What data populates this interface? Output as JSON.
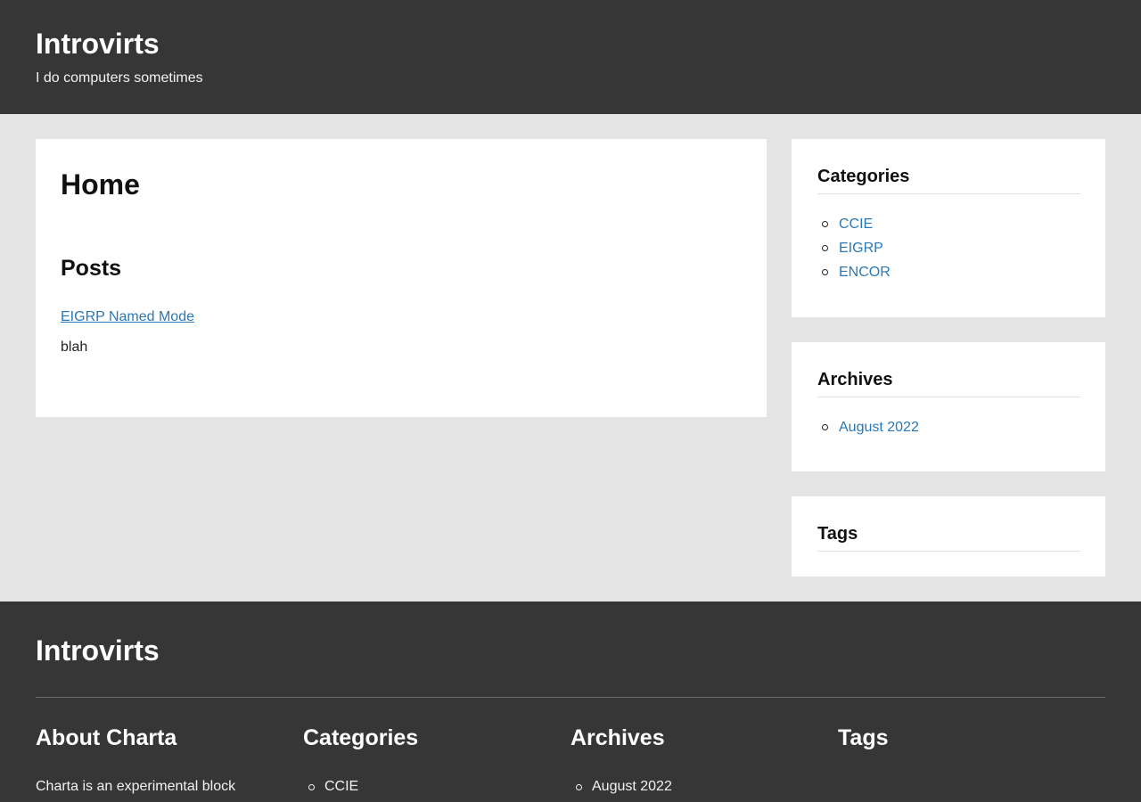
{
  "header": {
    "site_title": "Introvirts",
    "tagline": "I do computers sometimes"
  },
  "main": {
    "page_title": "Home",
    "posts_heading": "Posts",
    "posts": [
      {
        "title": "EIGRP Named Mode",
        "excerpt": "blah"
      }
    ]
  },
  "sidebar": {
    "categories": {
      "title": "Categories",
      "items": [
        "CCIE",
        "EIGRP",
        "ENCOR"
      ]
    },
    "archives": {
      "title": "Archives",
      "items": [
        "August 2022"
      ]
    },
    "tags": {
      "title": "Tags"
    }
  },
  "footer": {
    "site_title": "Introvirts",
    "about": {
      "title": "About Charta",
      "text": "Charta is an experimental block"
    },
    "categories": {
      "title": "Categories",
      "items": [
        "CCIE"
      ]
    },
    "archives": {
      "title": "Archives",
      "items": [
        "August 2022"
      ]
    },
    "tags": {
      "title": "Tags"
    }
  },
  "colors": {
    "header_bg": "#363636",
    "page_bg": "#e4e4e4",
    "link": "#2a78b6",
    "card_bg": "#ffffff"
  }
}
